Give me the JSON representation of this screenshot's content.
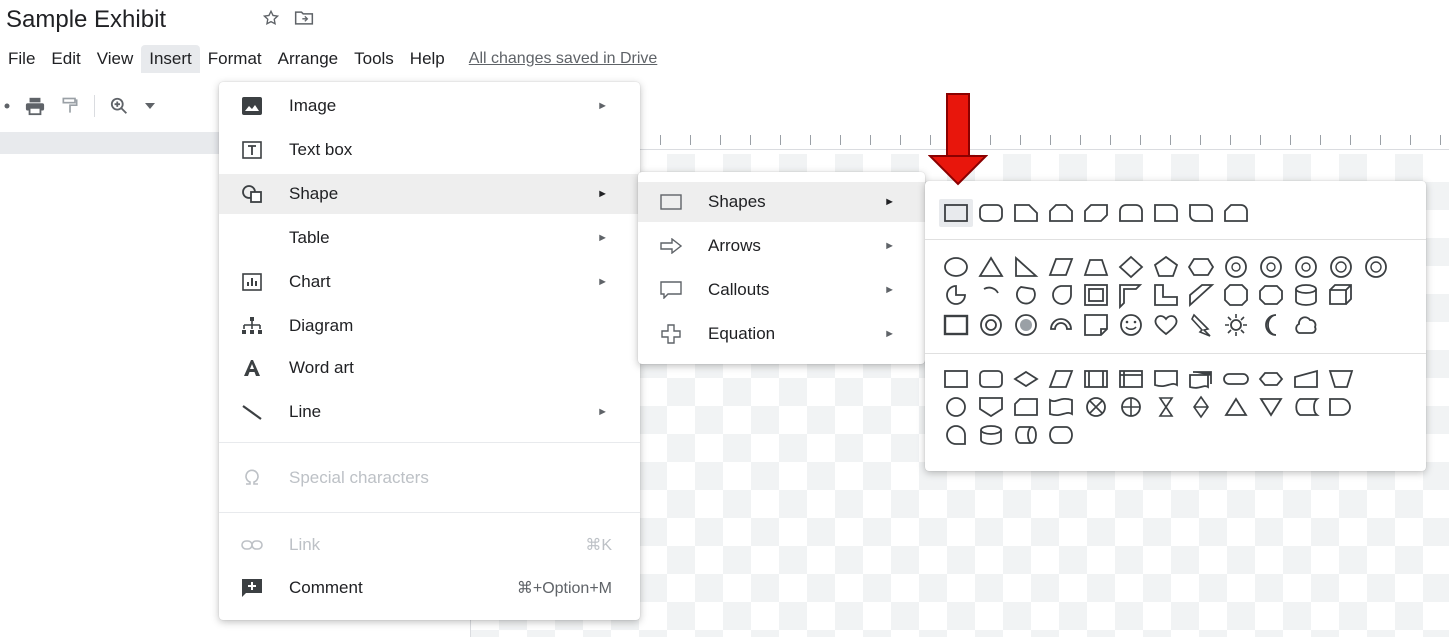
{
  "document": {
    "title": "Sample Exhibit"
  },
  "menubar": {
    "items": [
      "File",
      "Edit",
      "View",
      "Insert",
      "Format",
      "Arrange",
      "Tools",
      "Help"
    ],
    "active": "Insert",
    "save_status": "All changes saved in Drive"
  },
  "insert_menu": {
    "items": [
      {
        "label": "Image",
        "icon": "image-icon",
        "submenu": true
      },
      {
        "label": "Text box",
        "icon": "text-box-icon",
        "submenu": false
      },
      {
        "label": "Shape",
        "icon": "shape-icon",
        "submenu": true,
        "highlighted": true
      },
      {
        "label": "Table",
        "icon": "",
        "submenu": true
      },
      {
        "label": "Chart",
        "icon": "chart-icon",
        "submenu": true
      },
      {
        "label": "Diagram",
        "icon": "diagram-icon",
        "submenu": false
      },
      {
        "label": "Word art",
        "icon": "word-art-icon",
        "submenu": false
      },
      {
        "label": "Line",
        "icon": "line-icon",
        "submenu": true
      },
      {
        "label": "Special characters",
        "icon": "omega-icon",
        "disabled": true
      },
      {
        "label": "Link",
        "icon": "link-icon",
        "shortcut": "⌘K",
        "disabled": true
      },
      {
        "label": "Comment",
        "icon": "comment-icon",
        "shortcut": "⌘+Option+M"
      }
    ]
  },
  "shape_submenu": {
    "items": [
      {
        "label": "Shapes",
        "icon": "rectangle-icon",
        "highlighted": true
      },
      {
        "label": "Arrows",
        "icon": "arrow-icon"
      },
      {
        "label": "Callouts",
        "icon": "callout-icon"
      },
      {
        "label": "Equation",
        "icon": "plus-icon"
      }
    ]
  },
  "colors": {
    "accent_red": "#e8160c",
    "highlight": "#eeeeee",
    "text": "#202124",
    "muted": "#5f6368"
  }
}
